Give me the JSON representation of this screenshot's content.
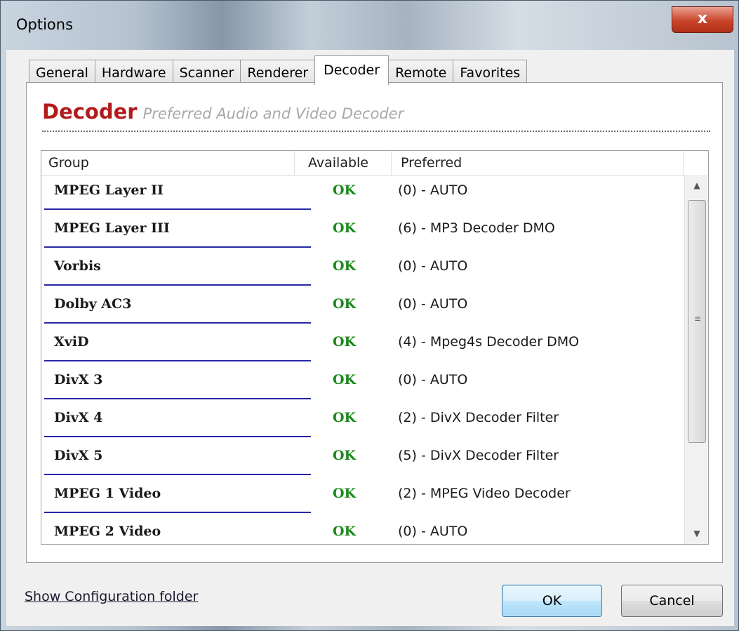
{
  "window": {
    "title": "Options",
    "close_glyph": "x"
  },
  "tabs": [
    {
      "label": "General",
      "active": false
    },
    {
      "label": "Hardware",
      "active": false
    },
    {
      "label": "Scanner",
      "active": false
    },
    {
      "label": "Renderer",
      "active": false
    },
    {
      "label": "Decoder",
      "active": true
    },
    {
      "label": "Remote",
      "active": false
    },
    {
      "label": "Favorites",
      "active": false
    }
  ],
  "panel": {
    "heading": "Decoder",
    "subheading": "Preferred Audio and Video Decoder"
  },
  "list": {
    "columns": {
      "group": "Group",
      "available": "Available",
      "preferred": "Preferred"
    },
    "rows": [
      {
        "group": "MPEG Layer II",
        "available": "OK",
        "preferred": "(0) - AUTO"
      },
      {
        "group": "MPEG Layer III",
        "available": "OK",
        "preferred": "(6) - MP3 Decoder DMO"
      },
      {
        "group": "Vorbis",
        "available": "OK",
        "preferred": "(0) - AUTO"
      },
      {
        "group": "Dolby AC3",
        "available": "OK",
        "preferred": "(0) - AUTO"
      },
      {
        "group": "XviD",
        "available": "OK",
        "preferred": "(4) - Mpeg4s Decoder DMO"
      },
      {
        "group": "DivX 3",
        "available": "OK",
        "preferred": "(0) - AUTO"
      },
      {
        "group": "DivX 4",
        "available": "OK",
        "preferred": "(2) - DivX Decoder Filter"
      },
      {
        "group": "DivX 5",
        "available": "OK",
        "preferred": "(5) - DivX Decoder Filter"
      },
      {
        "group": "MPEG 1 Video",
        "available": "OK",
        "preferred": "(2) - MPEG Video Decoder"
      },
      {
        "group": "MPEG 2 Video",
        "available": "OK",
        "preferred": "(0) - AUTO"
      }
    ]
  },
  "footer": {
    "config_link": "Show Configuration folder",
    "ok_label": "OK",
    "cancel_label": "Cancel"
  },
  "colors": {
    "heading": "#b31b1b",
    "ok_status": "#1a8a1a",
    "row_rule": "#2727a8"
  },
  "icons": {
    "close": "close-icon",
    "scroll_up": "chevron-up-icon",
    "scroll_down": "chevron-down-icon",
    "grip": "grip-icon"
  }
}
